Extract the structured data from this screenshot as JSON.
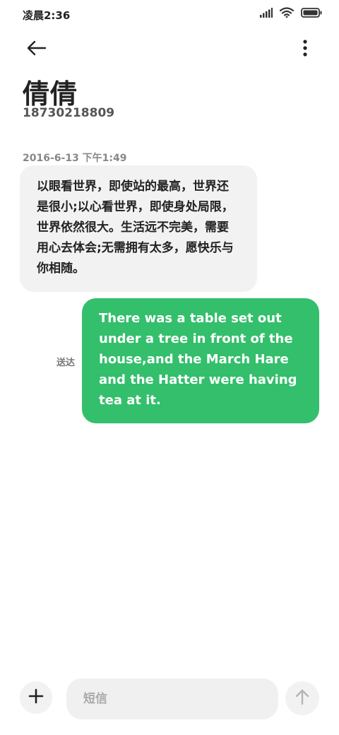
{
  "status_bar": {
    "time": "凌晨2:36",
    "icons": [
      "signal-icon",
      "wifi-icon",
      "battery-icon"
    ]
  },
  "header": {
    "back_icon": "back-arrow-icon",
    "more_icon": "more-vert-icon",
    "contact_name": "倩倩",
    "contact_number": "18730218809"
  },
  "conversation": {
    "timestamp": "2016-6-13 下午1:49",
    "messages": [
      {
        "direction": "incoming",
        "text": "以眼看世界，即使站的最高，世界还是很小;以心看世界，即使身处局限，世界依然很大。生活远不完美，需要用心去体会;无需拥有太多，愿快乐与你相随。"
      },
      {
        "direction": "outgoing",
        "status": "送达",
        "text": "There was a table set out under a tree in front of the house,and the March Hare and the Hatter were having tea at it."
      }
    ]
  },
  "composer": {
    "add_icon": "plus-icon",
    "placeholder": "短信",
    "value": "",
    "send_icon": "send-arrow-up-icon"
  },
  "colors": {
    "outgoing_bubble": "#33bf6b",
    "incoming_bubble": "#f2f2f2",
    "background": "#ffffff"
  }
}
